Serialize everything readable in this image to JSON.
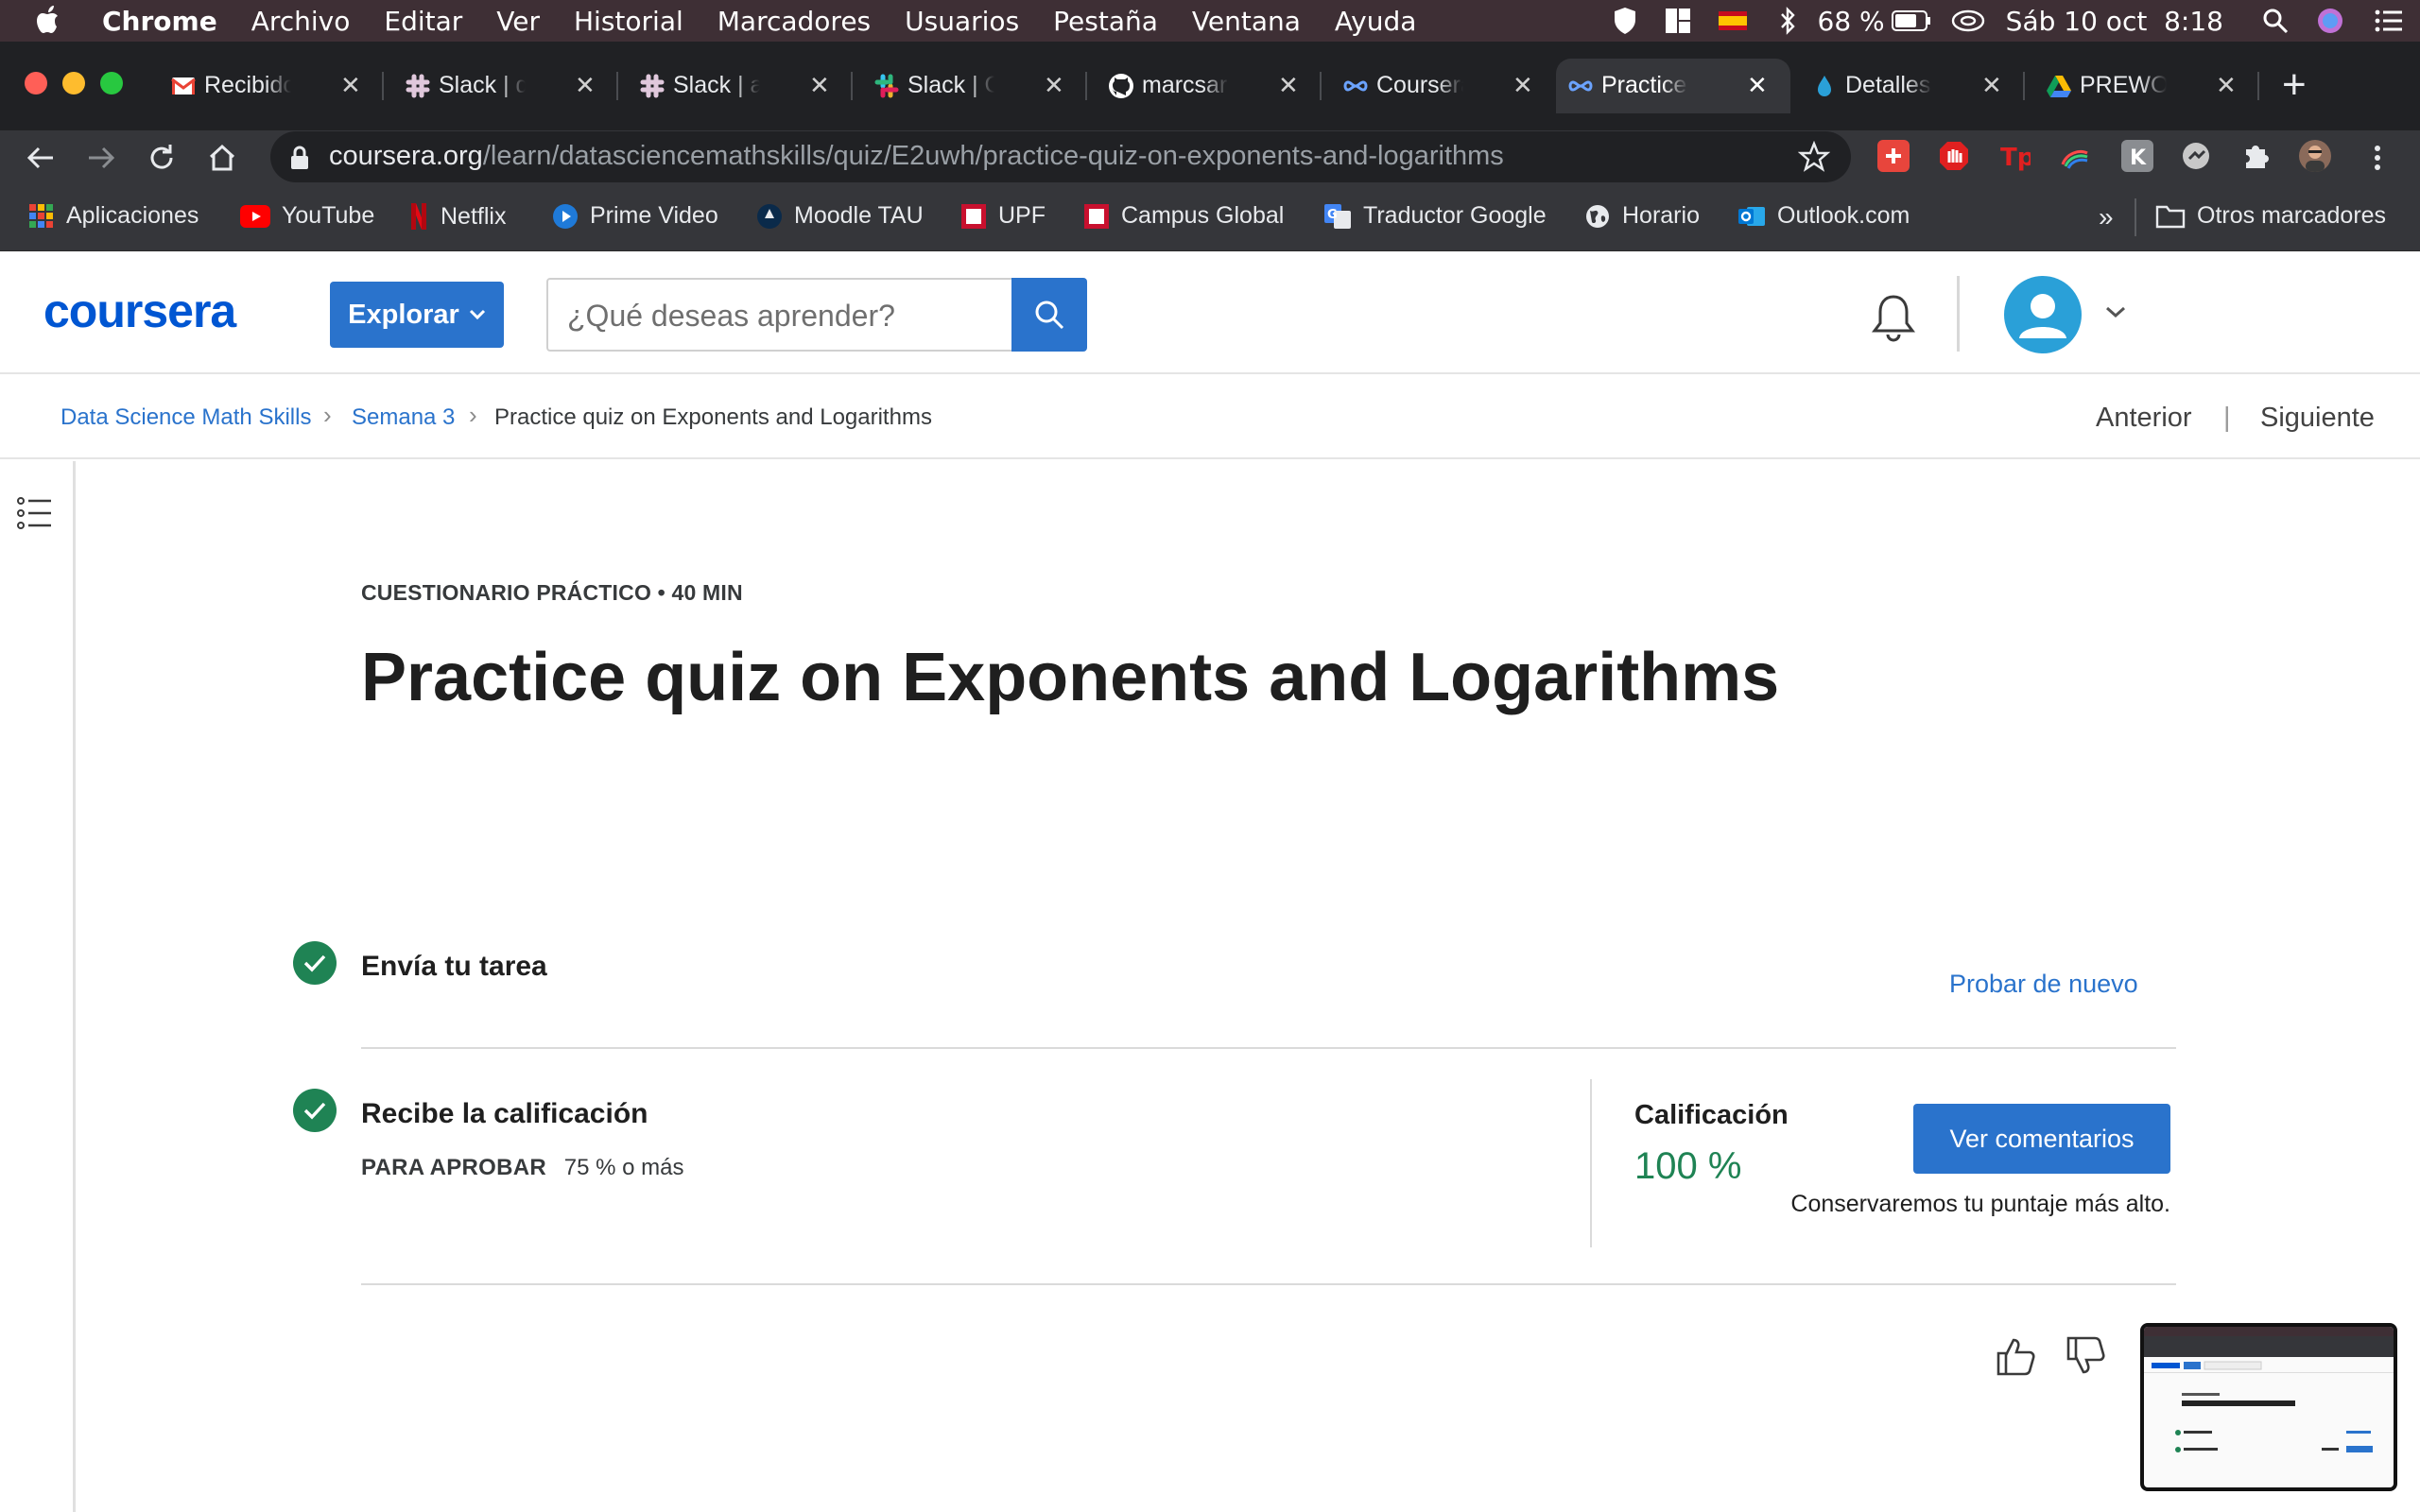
{
  "menubar": {
    "app": "Chrome",
    "items": [
      "Archivo",
      "Editar",
      "Ver",
      "Historial",
      "Marcadores",
      "Usuarios",
      "Pestaña",
      "Ventana",
      "Ayuda"
    ],
    "battery": "68 %",
    "datetime": "Sáb 10 oct  8:18"
  },
  "tabs": [
    {
      "title": "Recibidos",
      "icon": "gmail-icon",
      "color": "#ea4335"
    },
    {
      "title": "Slack | dat",
      "icon": "slack-icon",
      "color": "#d8d1d8"
    },
    {
      "title": "Slack | ann",
      "icon": "slack-icon",
      "color": "#d8d1d8"
    },
    {
      "title": "Slack | Ge",
      "icon": "slack-icon",
      "color": "#36c5f0"
    },
    {
      "title": "marcsarra",
      "icon": "github-icon",
      "color": "#ffffff"
    },
    {
      "title": "Coursera |",
      "icon": "coursera-icon",
      "color": "#6ba3ff"
    },
    {
      "title": "Practice qu",
      "icon": "coursera-icon",
      "color": "#6ba3ff",
      "active": true
    },
    {
      "title": "Detalles de",
      "icon": "drop-icon",
      "color": "#2aa0d8"
    },
    {
      "title": "PREWORK",
      "icon": "drive-icon",
      "color": "#fbbc04"
    }
  ],
  "address": {
    "domain": "coursera.org",
    "path": "/learn/datasciencemathskills/quiz/E2uwh/practice-quiz-on-exponents-and-logarithms"
  },
  "bookmarks": [
    {
      "label": "Aplicaciones",
      "icon": "apps-grid-icon",
      "color": "#ea4335"
    },
    {
      "label": "YouTube",
      "icon": "youtube-icon",
      "color": "#ff0000"
    },
    {
      "label": "Netflix",
      "icon": "netflix-icon",
      "color": "#e50914"
    },
    {
      "label": "Prime Video",
      "icon": "prime-video-icon",
      "color": "#1f7ad8"
    },
    {
      "label": "Moodle TAU",
      "icon": "moodle-icon",
      "color": "#0a2a4a"
    },
    {
      "label": "UPF",
      "icon": "upf-icon",
      "color": "#c8102e"
    },
    {
      "label": "Campus Global",
      "icon": "campus-icon",
      "color": "#c8102e"
    },
    {
      "label": "Traductor Google",
      "icon": "translate-icon",
      "color": "#4285f4"
    },
    {
      "label": "Horario",
      "icon": "globe-icon",
      "color": "#e8eaed"
    },
    {
      "label": "Outlook.com",
      "icon": "outlook-icon",
      "color": "#0078d4"
    }
  ],
  "bookmarks_more": "»",
  "bookmarks_other": "Otros marcadores",
  "header": {
    "logo": "coursera",
    "explore": "Explorar",
    "search_placeholder": "¿Qué deseas aprender?"
  },
  "breadcrumb": {
    "items": [
      "Data Science Math Skills",
      "Semana 3",
      "Practice quiz on Exponents and Logarithms"
    ],
    "prev": "Anterior",
    "divider": "|",
    "next": "Siguiente"
  },
  "quiz": {
    "eyebrow": "CUESTIONARIO PRÁCTICO • 40 MIN",
    "title": "Practice quiz on Exponents and Logarithms",
    "step1": "Envía tu tarea",
    "retry": "Probar de nuevo",
    "step2": "Recibe la calificación",
    "pass_label": "PARA APROBAR",
    "pass_value": "75 % o más",
    "grade_label": "Calificación",
    "grade_value": "100 %",
    "feedback_button": "Ver comentarios",
    "keep_note": "Conservaremos tu puntaje más alto."
  },
  "colors": {
    "brand": "#0056d2",
    "accent": "#2a73cc",
    "success": "#1f8354"
  }
}
